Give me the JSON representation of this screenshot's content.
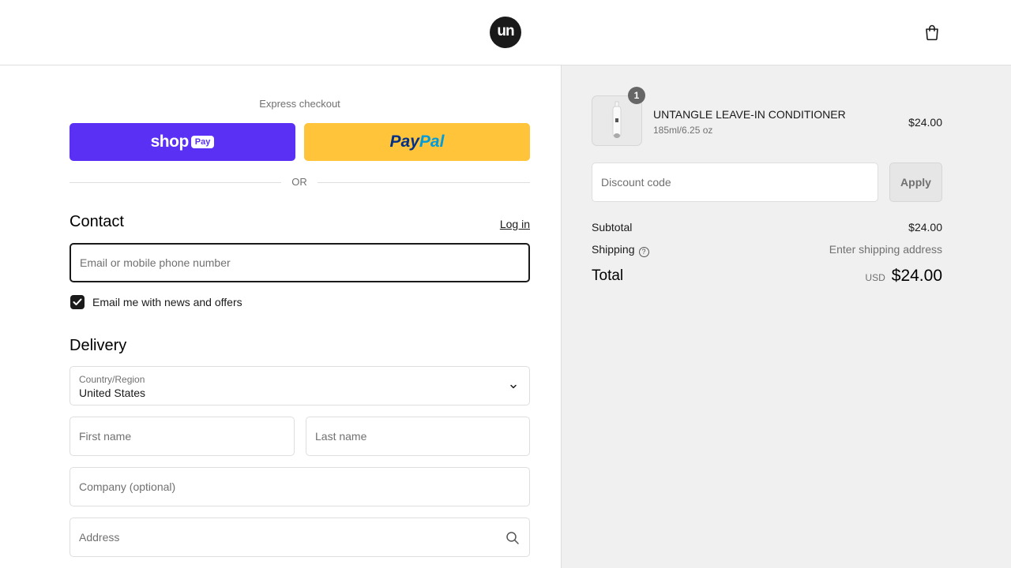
{
  "header": {
    "logo_text": "un",
    "logo_icon": "brand-logo",
    "cart_icon": "shopping-bag-icon"
  },
  "express": {
    "label": "Express checkout",
    "shoppay_word": "shop",
    "shoppay_pill": "Pay",
    "paypal_a": "Pay",
    "paypal_b": "Pal",
    "or_text": "OR"
  },
  "contact": {
    "title": "Contact",
    "login_label": "Log in",
    "email_placeholder": "Email or mobile phone number",
    "newsletter_label": "Email me with news and offers",
    "newsletter_checked": true
  },
  "delivery": {
    "title": "Delivery",
    "country_label": "Country/Region",
    "country_value": "United States",
    "first_name_placeholder": "First name",
    "last_name_placeholder": "Last name",
    "company_placeholder": "Company (optional)",
    "address_placeholder": "Address"
  },
  "summary": {
    "item": {
      "quantity": "1",
      "name": "UNTANGLE LEAVE-IN CONDITIONER",
      "variant": "185ml/6.25 oz",
      "price": "$24.00"
    },
    "discount_placeholder": "Discount code",
    "apply_label": "Apply",
    "subtotal_label": "Subtotal",
    "subtotal_value": "$24.00",
    "shipping_label": "Shipping",
    "shipping_value": "Enter shipping address",
    "total_label": "Total",
    "total_currency": "USD",
    "total_value": "$24.00"
  },
  "colors": {
    "shoppay": "#5a31f4",
    "paypal": "#ffc439",
    "summary_bg": "#f0f0f0"
  }
}
